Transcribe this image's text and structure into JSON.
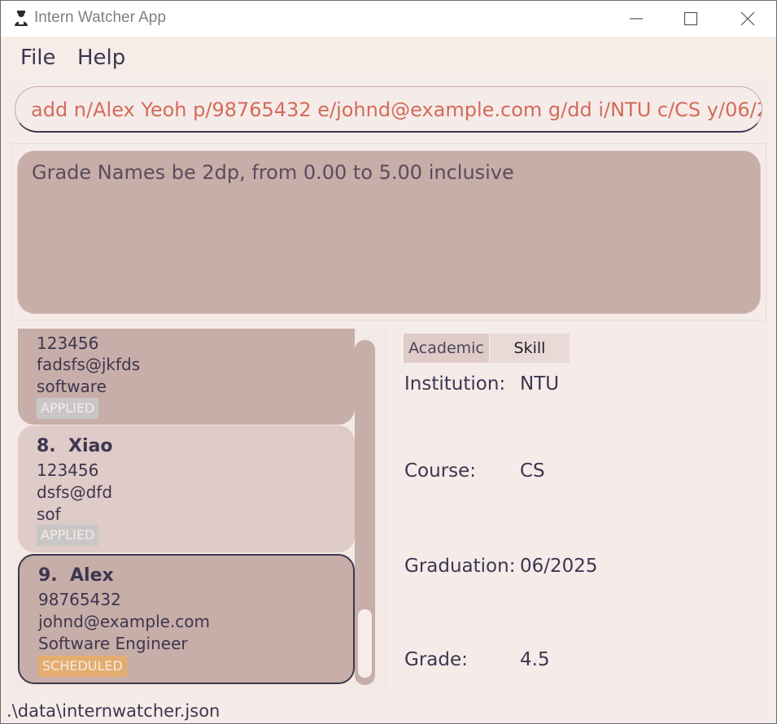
{
  "window": {
    "title": "Intern Watcher App",
    "icon": "person-icon"
  },
  "menu": {
    "file": "File",
    "help": "Help"
  },
  "command": {
    "value": "add n/Alex Yeoh p/98765432 e/johnd@example.com g/dd i/NTU c/CS y/06/2"
  },
  "result": {
    "message": "Grade Names be 2dp, from 0.00 to 5.00 inclusive"
  },
  "interns": [
    {
      "phone": "123456",
      "email": "fadsfs@jkfds",
      "role": "software",
      "status": "APPLIED"
    },
    {
      "index": "8.",
      "name": "Xiao",
      "phone": "123456",
      "email": "dsfs@dfd",
      "role": "sof",
      "status": "APPLIED"
    },
    {
      "index": "9.",
      "name": "Alex",
      "phone": "98765432",
      "email": "johnd@example.com",
      "role": "Software Engineer",
      "status": "SCHEDULED"
    }
  ],
  "tabs": {
    "academic": "Academic",
    "skill": "Skill"
  },
  "details": {
    "institution_label": "Institution:",
    "institution_value": "NTU",
    "course_label": "Course:",
    "course_value": "CS",
    "graduation_label": "Graduation:",
    "graduation_value": "06/2025",
    "grade_label": "Grade:",
    "grade_value": "4.5"
  },
  "status": {
    "path": ".\\data\\internwatcher.json"
  },
  "colors": {
    "accent_text": "#d46a5a",
    "card": "#c8aea8",
    "card_light": "#dfcbc7",
    "applied_badge": "#c9c6c6",
    "scheduled_badge": "#e4ad6f",
    "text": "#3d3650"
  }
}
